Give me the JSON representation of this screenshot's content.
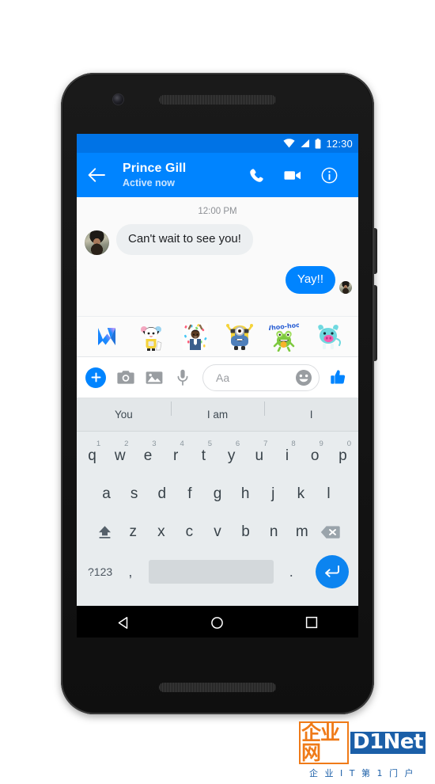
{
  "device": {
    "camera_icon": "front-camera",
    "earpiece_icon": "earpiece-speaker",
    "bottom_speaker_icon": "bottom-speaker"
  },
  "status_bar": {
    "clock": "12:30",
    "icons": [
      "wifi-icon",
      "signal-icon",
      "battery-icon"
    ],
    "background": "#0073e6"
  },
  "app_bar": {
    "background": "#0084ff",
    "back_icon": "back-arrow-icon",
    "peer_name": "Prince Gill",
    "peer_status": "Active now",
    "actions": [
      {
        "name": "voice-call",
        "icon": "phone-icon"
      },
      {
        "name": "video-call",
        "icon": "video-camera-icon"
      },
      {
        "name": "conversation-info",
        "icon": "info-icon"
      }
    ]
  },
  "thread": {
    "timestamp": "12:00 PM",
    "messages": [
      {
        "direction": "incoming",
        "text": "Can't wait to see you!",
        "has_avatar": true
      },
      {
        "direction": "outgoing",
        "text": "Yay!!",
        "has_avatar": true
      }
    ],
    "bubble_in_color": "#eceff1",
    "bubble_out_color": "#0084ff"
  },
  "sticker_tray": {
    "items": [
      {
        "name": "messenger-logo-sticker",
        "label": "M"
      },
      {
        "name": "cheering-boy-sticker",
        "label": ""
      },
      {
        "name": "confetti-celebration-sticker",
        "label": ""
      },
      {
        "name": "minion-sticker",
        "label": ""
      },
      {
        "name": "whoo-hoo-frog-sticker",
        "label": "Whoo-hoo!"
      },
      {
        "name": "blue-cow-sticker",
        "label": ""
      }
    ]
  },
  "composer": {
    "plus_icon": "plus-icon",
    "camera_icon": "camera-icon",
    "gallery_icon": "gallery-icon",
    "microphone_icon": "microphone-icon",
    "input_placeholder": "Aa",
    "input_value": "",
    "emoji_icon": "smiley-icon",
    "like_icon": "thumbs-up-icon",
    "accent": "#0084ff"
  },
  "suggestions": {
    "items": [
      "You",
      "I am",
      "I"
    ]
  },
  "keyboard": {
    "row1": [
      {
        "key": "q",
        "num": "1"
      },
      {
        "key": "w",
        "num": "2"
      },
      {
        "key": "e",
        "num": "3"
      },
      {
        "key": "r",
        "num": "4"
      },
      {
        "key": "t",
        "num": "5"
      },
      {
        "key": "y",
        "num": "6"
      },
      {
        "key": "u",
        "num": "7"
      },
      {
        "key": "i",
        "num": "8"
      },
      {
        "key": "o",
        "num": "9"
      },
      {
        "key": "p",
        "num": "0"
      }
    ],
    "row2": [
      "a",
      "s",
      "d",
      "f",
      "g",
      "h",
      "j",
      "k",
      "l"
    ],
    "row3": [
      "z",
      "x",
      "c",
      "v",
      "b",
      "n",
      "m"
    ],
    "shift_icon": "shift-icon",
    "backspace_icon": "backspace-icon",
    "symbols_label": "?123",
    "comma_label": ",",
    "period_label": ".",
    "space_label": "",
    "enter_icon": "enter-icon",
    "enter_color": "#0c84f0"
  },
  "nav_bar": {
    "back_icon": "nav-back-triangle-icon",
    "home_icon": "nav-home-circle-icon",
    "recents_icon": "nav-recents-square-icon"
  },
  "watermark": {
    "cn_name": "企业网",
    "brand": "D1Net",
    "subtitle": "企 业  I T  第 1 门 户",
    "orange": "#ef7a18",
    "blue": "#1b5fa8"
  }
}
